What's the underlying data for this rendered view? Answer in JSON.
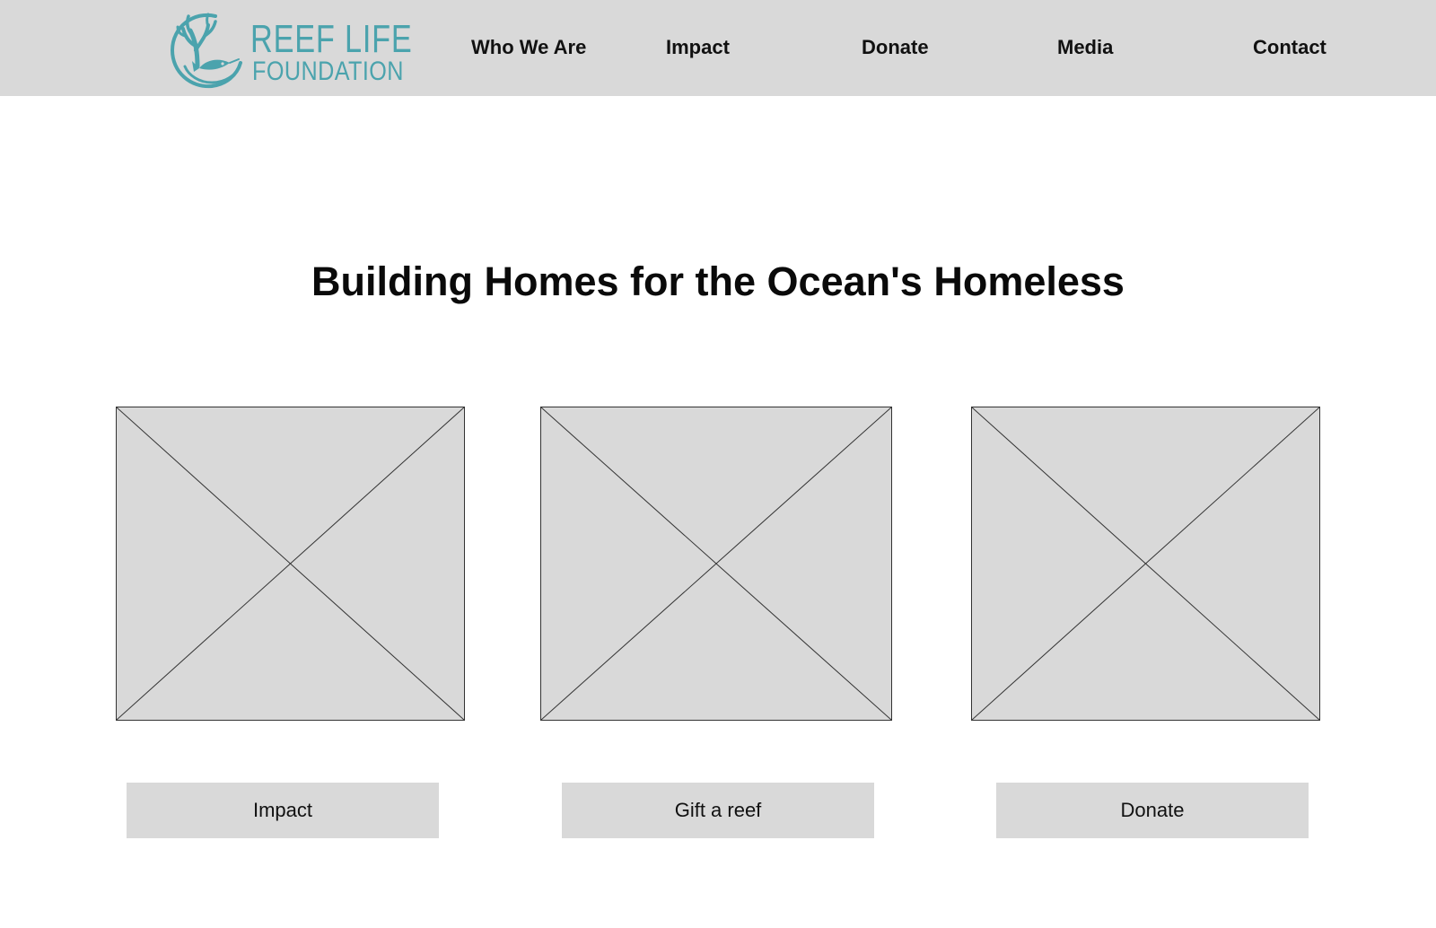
{
  "brand": {
    "name_line1": "REEF LIFE",
    "name_line2": "FOUNDATION",
    "accent_color": "#4ba3ad",
    "emblem_icon": "coral-fish-icon"
  },
  "nav": {
    "items": [
      {
        "label": "Who We Are"
      },
      {
        "label": "Impact"
      },
      {
        "label": "Donate"
      },
      {
        "label": "Media"
      },
      {
        "label": "Contact"
      }
    ]
  },
  "hero": {
    "title": "Building Homes for the Ocean's Homeless"
  },
  "cards": [
    {
      "image_icon": "image-placeholder-icon",
      "button_label": "Impact"
    },
    {
      "image_icon": "image-placeholder-icon",
      "button_label": "Gift a reef"
    },
    {
      "image_icon": "image-placeholder-icon",
      "button_label": "Donate"
    }
  ],
  "colors": {
    "navbar_bg": "#d9d9d9",
    "placeholder_bg": "#d9d9d9",
    "text": "#111111"
  }
}
